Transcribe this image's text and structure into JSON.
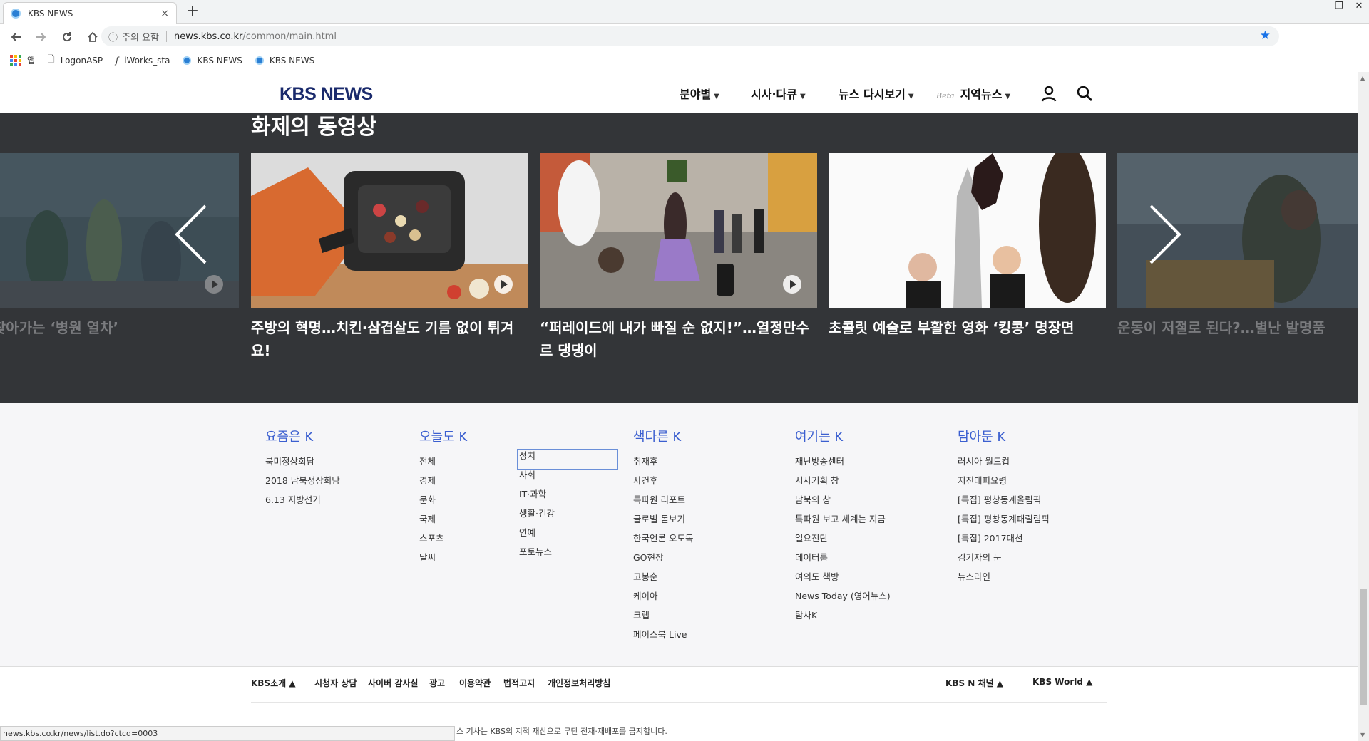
{
  "browser": {
    "tab_title": "KBS NEWS",
    "tab_close": "×",
    "new_tab": "+",
    "url_warning": "주의 요함",
    "url_host": "news.kbs.co.kr",
    "url_path": "/common/main.html",
    "window_controls": [
      "–",
      "❐",
      "✕"
    ],
    "bookmarks": [
      {
        "label": "앱",
        "icon": "apps-icon"
      },
      {
        "label": "LogonASP",
        "icon": "page-icon"
      },
      {
        "label": "iWorks_sta",
        "icon": "iworks-icon"
      },
      {
        "label": "KBS NEWS",
        "icon": "kbs-favicon-icon"
      },
      {
        "label": "KBS NEWS",
        "icon": "kbs-favicon-icon"
      }
    ],
    "status_url": "news.kbs.co.kr/news/list.do?ctcd=0003"
  },
  "header": {
    "logo": "KBS NEWS",
    "menu": [
      {
        "label": "분야별"
      },
      {
        "label": "시사·다큐"
      },
      {
        "label": "뉴스 다시보기"
      },
      {
        "label": "지역뉴스",
        "badge": "Beta"
      }
    ]
  },
  "videos": {
    "title": "화제의 동영상",
    "items": [
      {
        "caption": "민가 찾아가는 ‘병원 열차’",
        "dim": true
      },
      {
        "caption": "주방의 혁명…치킨·삼겹살도 기름 없이 튀겨요!",
        "dim": false
      },
      {
        "caption": "“퍼레이드에 내가 빠질 순 없지!”…열정만수르 댕댕이",
        "dim": false
      },
      {
        "caption": "초콜릿 예술로 부활한 영화 ‘킹콩’ 명장면",
        "dim": false
      },
      {
        "caption": "운동이 저절로 된다?…별난 발명품",
        "dim": true
      }
    ]
  },
  "sitemap": {
    "yojeum": {
      "title": "요즘은 K",
      "items": [
        "북미정상회담",
        "2018 남북정상회담",
        "6.13 지방선거"
      ]
    },
    "oneuldo": {
      "title": "오늘도 K",
      "items_a": [
        "전체",
        "경제",
        "문화",
        "국제",
        "스포츠",
        "날씨"
      ],
      "items_b": [
        "정치",
        "사회",
        "IT·과학",
        "생활·건강",
        "연예",
        "포토뉴스"
      ]
    },
    "saekdareun": {
      "title": "색다른 K",
      "items": [
        "취재후",
        "사건후",
        "특파원 리포트",
        "글로벌 돋보기",
        "한국언론 오도독",
        "GO현장",
        "고봉순",
        "케이아",
        "크랩",
        "페이스북 Live"
      ]
    },
    "yeogineun": {
      "title": "여기는 K",
      "items": [
        "재난방송센터",
        "시사기획 창",
        "남북의 창",
        "특파원 보고 세계는 지금",
        "일요진단",
        "데이터룸",
        "여의도 책방",
        "News Today (영어뉴스)",
        "탐사K"
      ]
    },
    "damadun": {
      "title": "담아둔 K",
      "items": [
        "러시아 월드컵",
        "지진대피요령",
        "[특집] 평창동계올림픽",
        "[특집] 평창동계패럴림픽",
        "[특집] 2017대선",
        "김기자의 눈",
        "뉴스라인"
      ]
    }
  },
  "footer": {
    "links": [
      "KBS소개 ▲",
      "시청자 상담",
      "사이버 감사실",
      "광고",
      "이용약관",
      "법적고지",
      "개인정보처리방침"
    ],
    "right": [
      "KBS N 채널 ▲",
      "KBS World ▲"
    ],
    "copyright": "스 기사는 KBS의 지적 재산으로 무단 전재·재배포를 금지합니다."
  }
}
